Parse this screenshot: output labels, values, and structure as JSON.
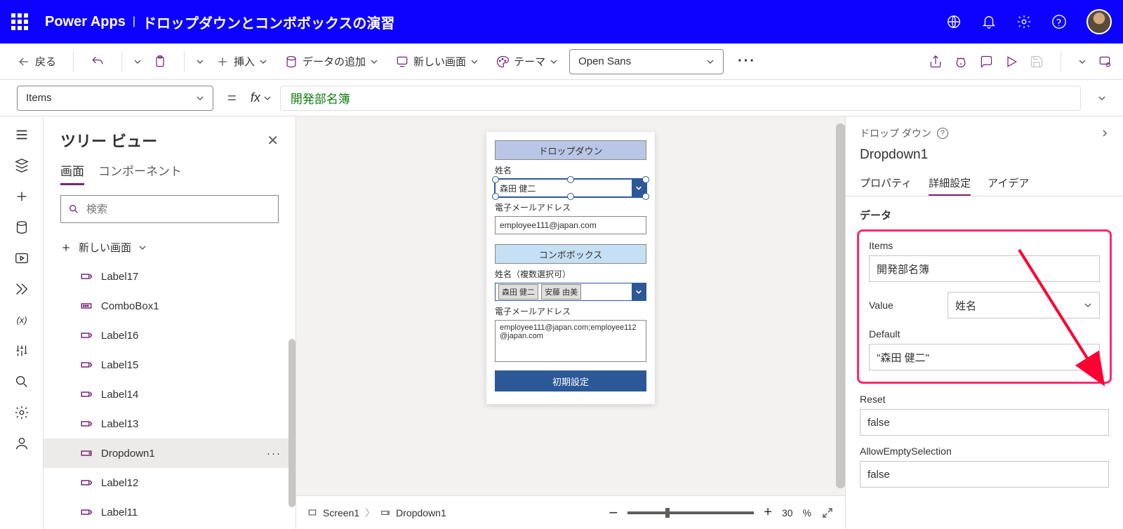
{
  "header": {
    "app": "Power Apps",
    "sep": "|",
    "title": "ドロップダウンとコンボボックスの演習"
  },
  "toolbar": {
    "back": "戻る",
    "insert": "挿入",
    "add_data": "データの追加",
    "new_screen": "新しい画面",
    "theme": "テーマ",
    "font": "Open Sans"
  },
  "formula": {
    "property": "Items",
    "value": "開発部名簿"
  },
  "tree": {
    "title": "ツリー ビュー",
    "tabs": {
      "screens": "画面",
      "components": "コンポーネント"
    },
    "search_placeholder": "検索",
    "new_screen": "新しい画面",
    "items": [
      {
        "icon": "label",
        "name": "Label17"
      },
      {
        "icon": "combo",
        "name": "ComboBox1"
      },
      {
        "icon": "label",
        "name": "Label16"
      },
      {
        "icon": "label",
        "name": "Label15"
      },
      {
        "icon": "label",
        "name": "Label14"
      },
      {
        "icon": "label",
        "name": "Label13"
      },
      {
        "icon": "dropdown",
        "name": "Dropdown1",
        "selected": true
      },
      {
        "icon": "label",
        "name": "Label12"
      },
      {
        "icon": "label",
        "name": "Label11"
      }
    ]
  },
  "canvas": {
    "dd_header": "ドロップダウン",
    "dd_name_label": "姓名",
    "dd_value": "森田 健二",
    "dd_email_label": "電子メールアドレス",
    "dd_email_value": "employee111@japan.com",
    "cb_header": "コンボボックス",
    "cb_name_label": "姓名（複数選択可）",
    "cb_chip1": "森田 健二",
    "cb_chip2": "安藤 由美",
    "cb_email_label": "電子メールアドレス",
    "cb_email_value": "employee111@japan.com;employee112@japan.com",
    "reset_btn": "初期設定"
  },
  "breadcrumb": {
    "screen": "Screen1",
    "control": "Dropdown1"
  },
  "zoom": {
    "pct": "30",
    "suffix": "%"
  },
  "right": {
    "type": "ドロップ ダウン",
    "name": "Dropdown1",
    "tabs": {
      "props": "プロパティ",
      "advanced": "詳細設定",
      "ideas": "アイデア"
    },
    "section_data": "データ",
    "items_label": "Items",
    "items_value": "開発部名簿",
    "value_label": "Value",
    "value_value": "姓名",
    "default_label": "Default",
    "default_value": "\"森田 健二\"",
    "reset_label": "Reset",
    "reset_value": "false",
    "allow_label": "AllowEmptySelection",
    "allow_value": "false"
  }
}
